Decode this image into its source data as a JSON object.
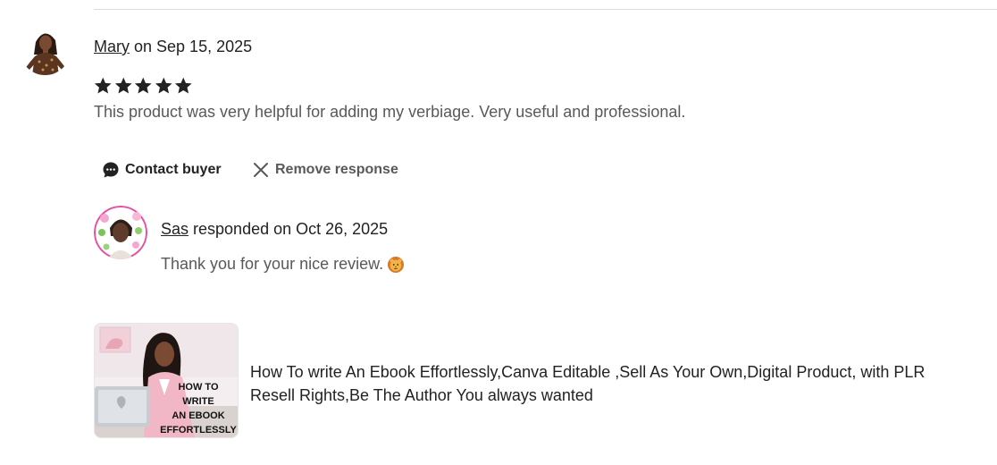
{
  "review": {
    "reviewer_name": "Mary",
    "date_prefix": " on Sep 15, 2025",
    "rating": 5,
    "text": "This product was very helpful for adding my verbiage. Very useful and professional."
  },
  "actions": {
    "contact_label": "Contact buyer",
    "remove_label": "Remove response"
  },
  "response": {
    "author_name": "Sas",
    "date_text": " responded on Oct 26, 2025",
    "text": "Thank you for your nice review."
  },
  "product": {
    "title": "How To write An Ebook Effortlessly,Canva Editable ,Sell As Your Own,Digital Product, with PLR Resell Rights,Be The Author You always wanted",
    "thumbnail_text": [
      "HOW TO",
      "WRITE",
      "AN EBOOK",
      "EFFORTLESSLY"
    ]
  },
  "colors": {
    "star": "#222222",
    "muted_text": "#595959"
  },
  "icons": {
    "contact": "chat-bubble-icon",
    "remove": "close-icon",
    "emoji": "lion-face-emoji"
  }
}
